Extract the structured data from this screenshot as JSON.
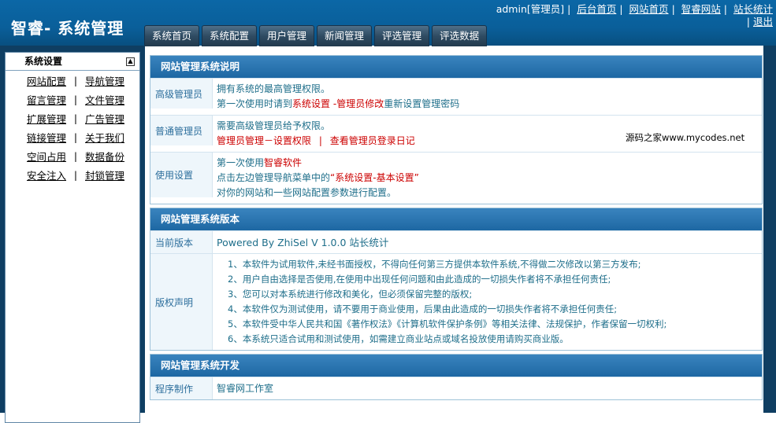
{
  "app": {
    "title": "智睿- 系统管理"
  },
  "user_links": {
    "user": "admin[管理员]",
    "items": [
      "后台首页",
      "网站首页",
      "智睿网站",
      "站长统计",
      "退出"
    ]
  },
  "tabs": [
    "系统首页",
    "系统配置",
    "用户管理",
    "新闻管理",
    "评选管理",
    "评选数据"
  ],
  "sidebar": {
    "title": "系统设置",
    "rows": [
      [
        "网站配置",
        "导航管理"
      ],
      [
        "留言管理",
        "文件管理"
      ],
      [
        "扩展管理",
        "广告管理"
      ],
      [
        "链接管理",
        "关于我们"
      ],
      [
        "空间占用",
        "数据备份"
      ],
      [
        "安全注入",
        "封锁管理"
      ]
    ]
  },
  "panel1": {
    "title": "网站管理系统说明",
    "senior": {
      "label": "高级管理员",
      "line1": "拥有系统的最高管理权限。",
      "line2_prefix": "第一次使用时请到",
      "line2_link1": "系统设置",
      "line2_dash": " -",
      "line2_link2": "管理员修改",
      "line2_suffix": "重新设置管理密码"
    },
    "normal": {
      "label": "普通管理员",
      "line1": "需要高级管理员给予权限。",
      "link1": "管理员管理－设置权限",
      "sep": "|",
      "link2": "查看管理员登录日记"
    },
    "usage": {
      "label": "使用设置",
      "line1_prefix": "第一次使用",
      "line1_link": "智睿软件",
      "line2_prefix": "点击左边管理导航菜单中的",
      "line2_link": "“系统设置-基本设置”",
      "line3": "对你的网站和一些网站配置参数进行配置。"
    }
  },
  "watermark": "源码之家www.mycodes.net",
  "panel2": {
    "title": "网站管理系统版本",
    "version_label": "当前版本",
    "version_value": "Powered By ZhiSel V 1.0.0 站长统计",
    "rights_label": "版权声明",
    "rights": [
      "1、本软件为试用软件,未经书面授权，不得向任何第三方提供本软件系统,不得做二次修改以第三方发布;",
      "2、用户自由选择是否使用,在使用中出现任何问题和由此造成的一切损失作者将不承担任何责任;",
      "3、您可以对本系统进行修改和美化，但必须保留完整的版权;",
      "4、本软件仅为测试使用，请不要用于商业使用，后果由此造成的一切损失作者将不承担任何责任;",
      "5、本软件受中华人民共和国《著作权法》《计算机软件保护条例》等相关法律、法规保护，作者保留一切权利;",
      "6、本系统只适合试用和测试使用，如需建立商业站点或域名投放使用请购买商业版。"
    ]
  },
  "panel3": {
    "title": "网站管理系统开发",
    "maker_label": "程序制作",
    "maker_value": "智睿网工作室"
  },
  "colors": {
    "header": "#0b67a6",
    "panel_title": "#1d67a3",
    "link_red": "#cc0000"
  }
}
